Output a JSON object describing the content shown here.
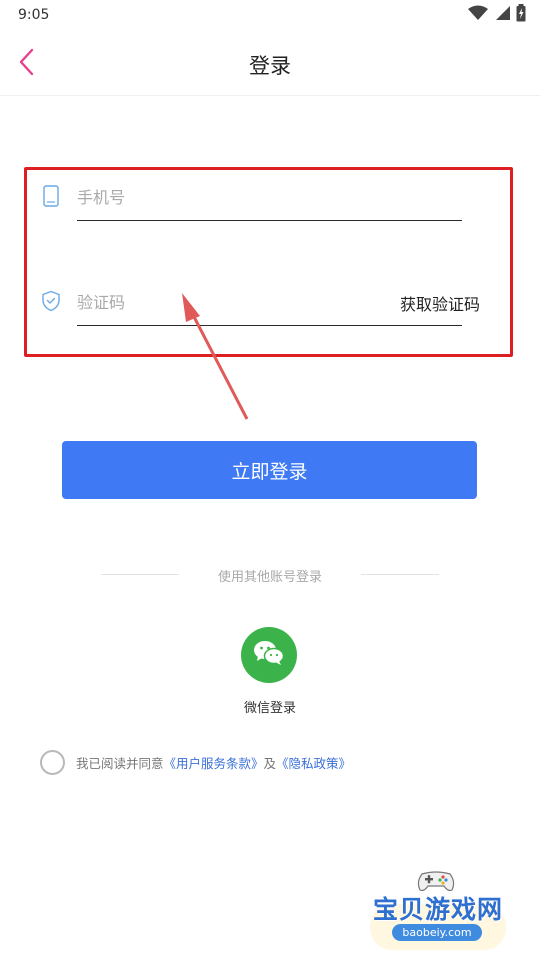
{
  "status_bar": {
    "time": "9:05",
    "icons": [
      "wifi-icon",
      "signal-icon",
      "battery-charging-icon"
    ]
  },
  "header": {
    "back_icon": "chevron-left-icon",
    "title": "登录"
  },
  "form": {
    "phone": {
      "icon": "phone-icon",
      "placeholder": "手机号",
      "value": ""
    },
    "code": {
      "icon": "shield-check-icon",
      "placeholder": "验证码",
      "value": "",
      "get_code_label": "获取验证码"
    }
  },
  "login_button": {
    "label": "立即登录"
  },
  "other_login": {
    "divider_text": "使用其他账号登录",
    "wechat": {
      "icon": "wechat-icon",
      "label": "微信登录"
    }
  },
  "agreement": {
    "checked": false,
    "prefix": "我已阅读并同意",
    "terms_link": "《用户服务条款》",
    "conjunction": "及",
    "privacy_link": "《隐私政策》"
  },
  "watermark": {
    "title": "宝贝游戏网",
    "domain": "baobeiy.com"
  },
  "colors": {
    "accent": "#3f79f4",
    "back_arrow": "#e8408f",
    "wechat": "#3cb34a",
    "highlight": "#dd1f24",
    "link": "#3a6fd6"
  }
}
